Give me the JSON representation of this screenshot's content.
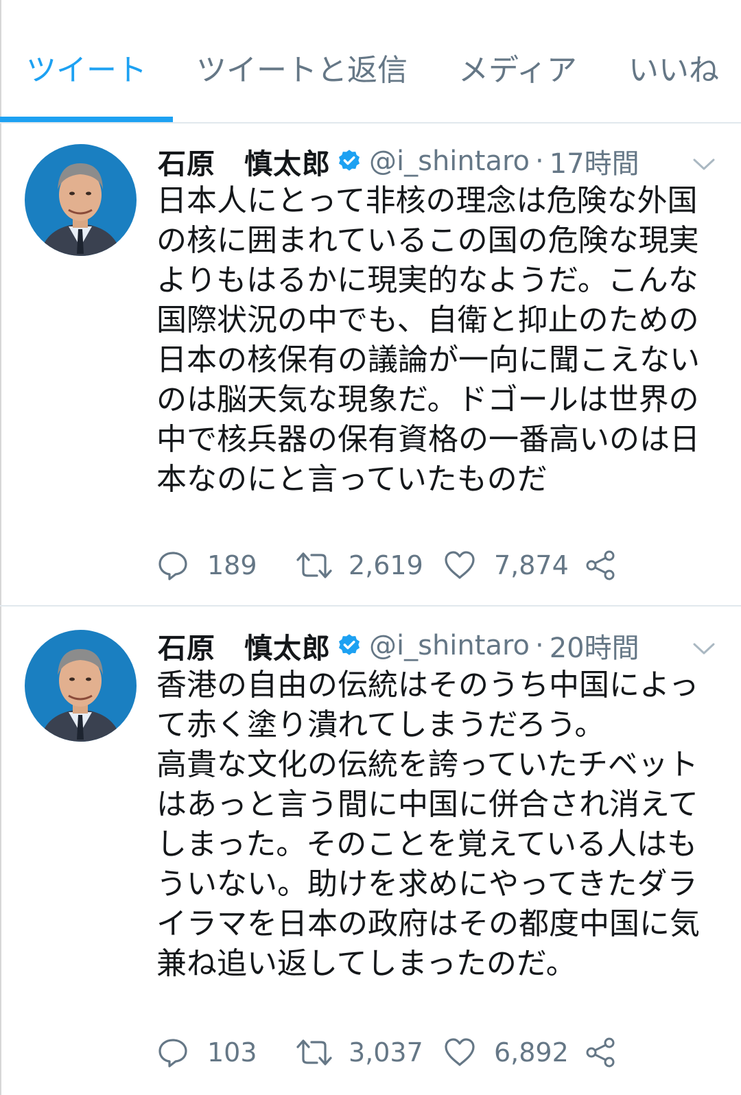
{
  "tabs": [
    {
      "label": "ツイート",
      "active": true
    },
    {
      "label": "ツイートと返信",
      "active": false
    },
    {
      "label": "メディア",
      "active": false
    },
    {
      "label": "いいね",
      "active": false
    }
  ],
  "colors": {
    "accent": "#1da1f2",
    "secondary_text": "#657786",
    "primary_text": "#14171a",
    "separator": "#e1e8ed",
    "avatar_background": "#1a7fc1"
  },
  "tweets": [
    {
      "display_name": "石原　慎太郎",
      "verified_icon": "verified-badge-icon",
      "handle": "@i_shintaro",
      "separator": "·",
      "time": "17時間",
      "text": "日本人にとって非核の理念は危険な外国の核に囲まれているこの国の危険な現実よりもはるかに現実的なようだ。こんな国際状況の中でも、自衛と抑止のための日本の核保有の議論が一向に聞こえないのは脳天気な現象だ。ドゴールは世界の中で核兵器の保有資格の一番高いのは日本なのにと言っていたものだ",
      "replies": "189",
      "retweets": "2,619",
      "likes": "7,874"
    },
    {
      "display_name": "石原　慎太郎",
      "verified_icon": "verified-badge-icon",
      "handle": "@i_shintaro",
      "separator": "·",
      "time": "20時間",
      "text": "香港の自由の伝統はそのうち中国によって赤く塗り潰れてしまうだろう。\n高貴な文化の伝統を誇っていたチベットはあっと言う間に中国に併合され消えてしまった。そのことを覚えている人はもういない。助けを求めにやってきたダライラマを日本の政府はその都度中国に気兼ね追い返してしまったのだ。",
      "replies": "103",
      "retweets": "3,037",
      "likes": "6,892"
    }
  ]
}
